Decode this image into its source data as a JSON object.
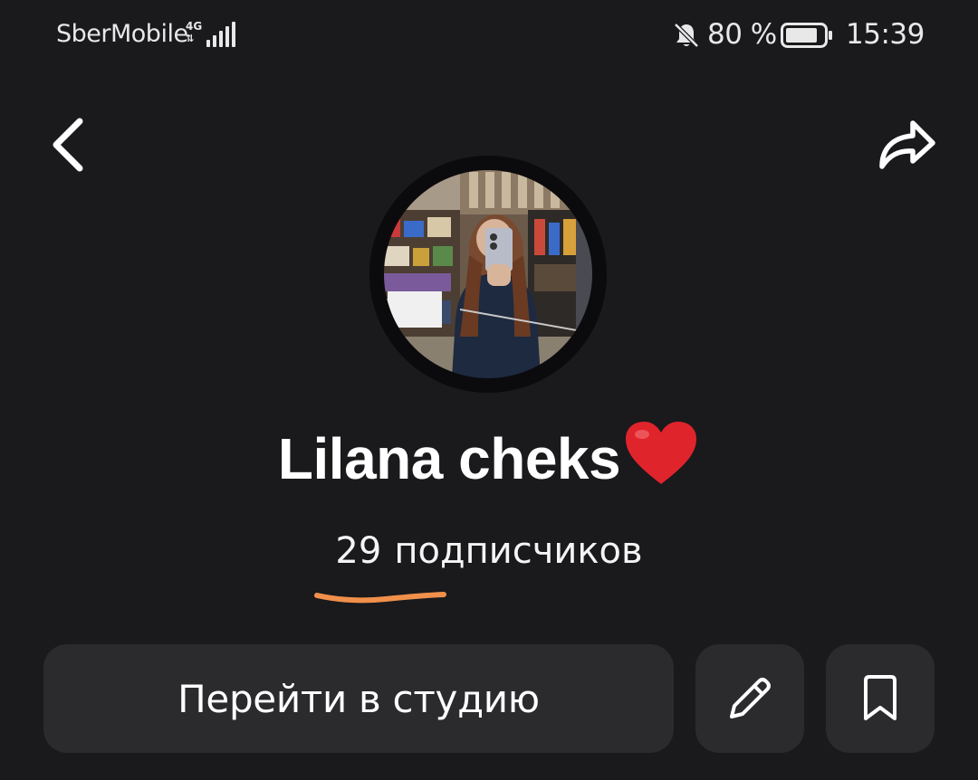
{
  "status_bar": {
    "carrier": "SberMobile",
    "network_type": "4G",
    "signal_icon": "signal-bars-icon",
    "notifications_icon": "bell-off-icon",
    "battery_percent": "80 %",
    "battery_icon": "battery-icon",
    "time": "15:39"
  },
  "nav": {
    "back_icon": "chevron-left-icon",
    "share_icon": "share-arrow-icon"
  },
  "profile": {
    "avatar": "profile-photo",
    "name": "Lilana cheks",
    "name_emoji": "❤",
    "subscribers_count": "29",
    "subscribers_label": "подписчиков"
  },
  "actions": {
    "studio_label": "Перейти в студию",
    "edit_icon": "pencil-icon",
    "bookmark_icon": "bookmark-icon"
  },
  "colors": {
    "background": "#1a191c",
    "button_bg": "#2b2a2d",
    "text": "#ffffff",
    "heart": "#e0242c",
    "underline_annotation": "#f0904a"
  }
}
